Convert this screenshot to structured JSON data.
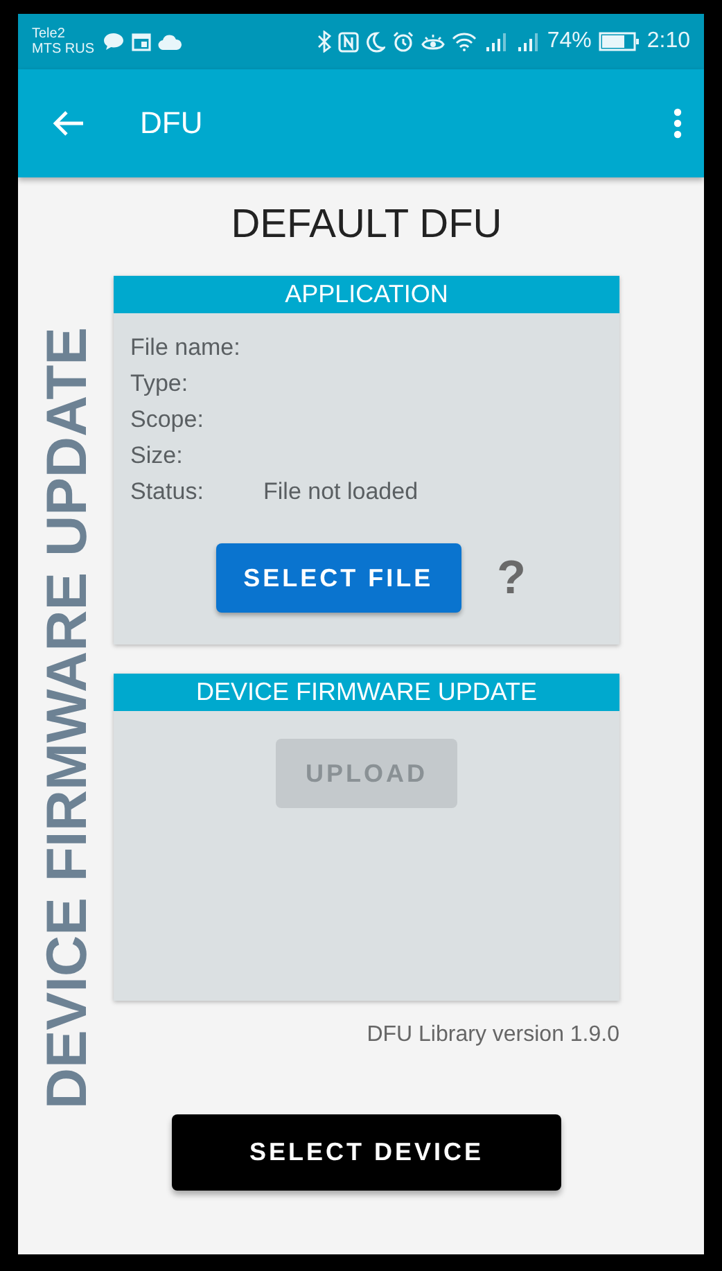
{
  "status_bar": {
    "carrier_1": "Tele2",
    "carrier_2": "MTS RUS",
    "battery_percent": "74%",
    "time": "2:10"
  },
  "app_bar": {
    "title": "DFU"
  },
  "side_title": "DEVICE FIRMWARE UPDATE",
  "heading": "DEFAULT DFU",
  "application": {
    "header": "APPLICATION",
    "fields": [
      {
        "label": "File name:"
      },
      {
        "label": "Type:"
      },
      {
        "label": "Scope:"
      },
      {
        "label": "Size:"
      },
      {
        "label": "Status:",
        "value": "File not loaded"
      }
    ],
    "select_button": {
      "label": "SELECT FILE",
      "disabled": false
    },
    "help": "?"
  },
  "dfu": {
    "header": "DEVICE FIRMWARE UPDATE",
    "upload_button": {
      "label": "UPLOAD",
      "disabled": true
    }
  },
  "version": "DFU Library version 1.9.0",
  "select_device_button": {
    "label": "SELECT DEVICE"
  }
}
